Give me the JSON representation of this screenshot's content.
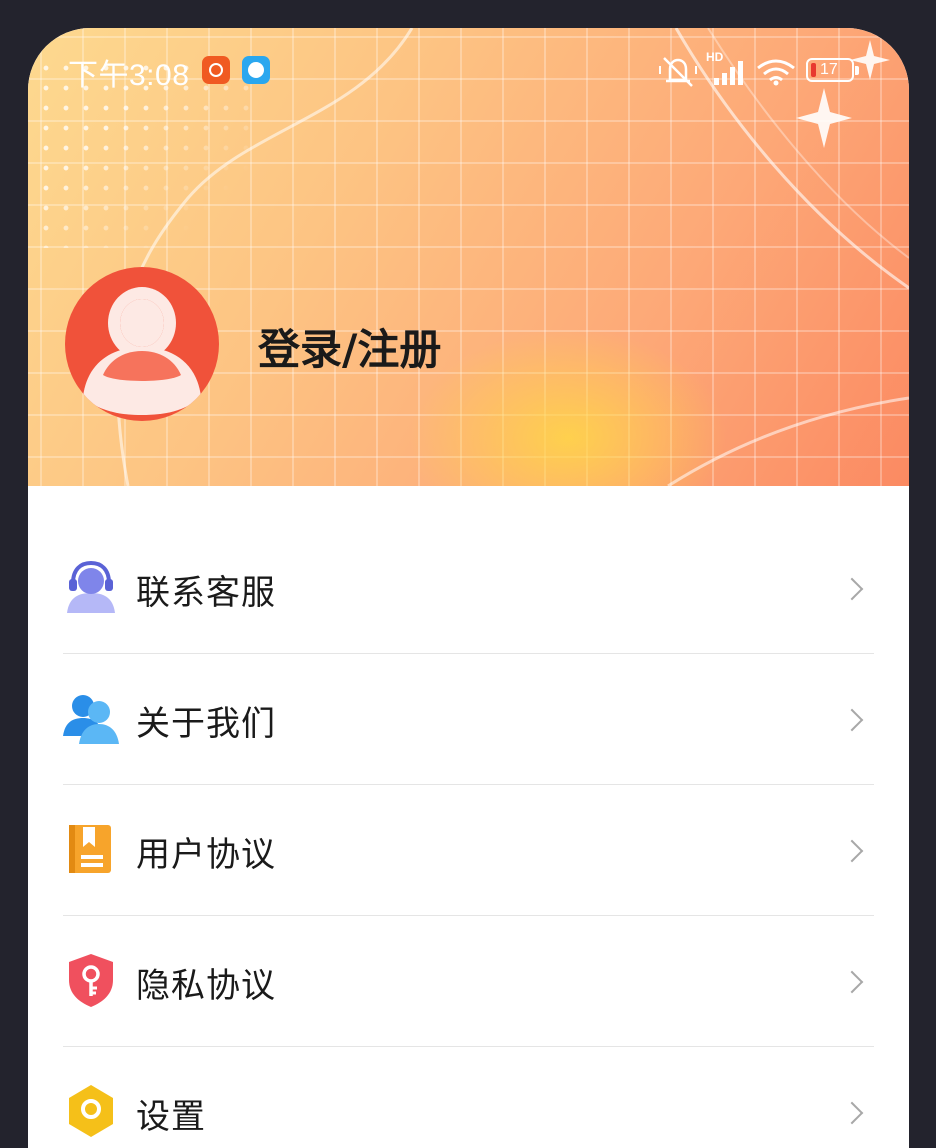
{
  "status_bar": {
    "time": "下午3:08",
    "network_label": "HD",
    "battery_level": "17",
    "battery_color": "#e8382f"
  },
  "icons": {
    "status_app_1": "video-app-icon",
    "status_app_2": "chat-app-icon",
    "mute": "bell-off-icon",
    "signal": "signal-icon",
    "wifi": "wifi-icon",
    "battery": "battery-icon"
  },
  "profile": {
    "login_label": "登录/注册",
    "avatar_color": "#f0523a"
  },
  "colors": {
    "header_gradient": [
      "#fdd98f",
      "#fdc483",
      "#fda877",
      "#fb8a62"
    ],
    "frame": "#23232d"
  },
  "menu": {
    "items": [
      {
        "label": "联系客服",
        "icon": "customer-service-icon"
      },
      {
        "label": "关于我们",
        "icon": "users-icon"
      },
      {
        "label": "用户协议",
        "icon": "book-icon"
      },
      {
        "label": "隐私协议",
        "icon": "shield-key-icon"
      },
      {
        "label": "设置",
        "icon": "settings-icon"
      }
    ]
  }
}
